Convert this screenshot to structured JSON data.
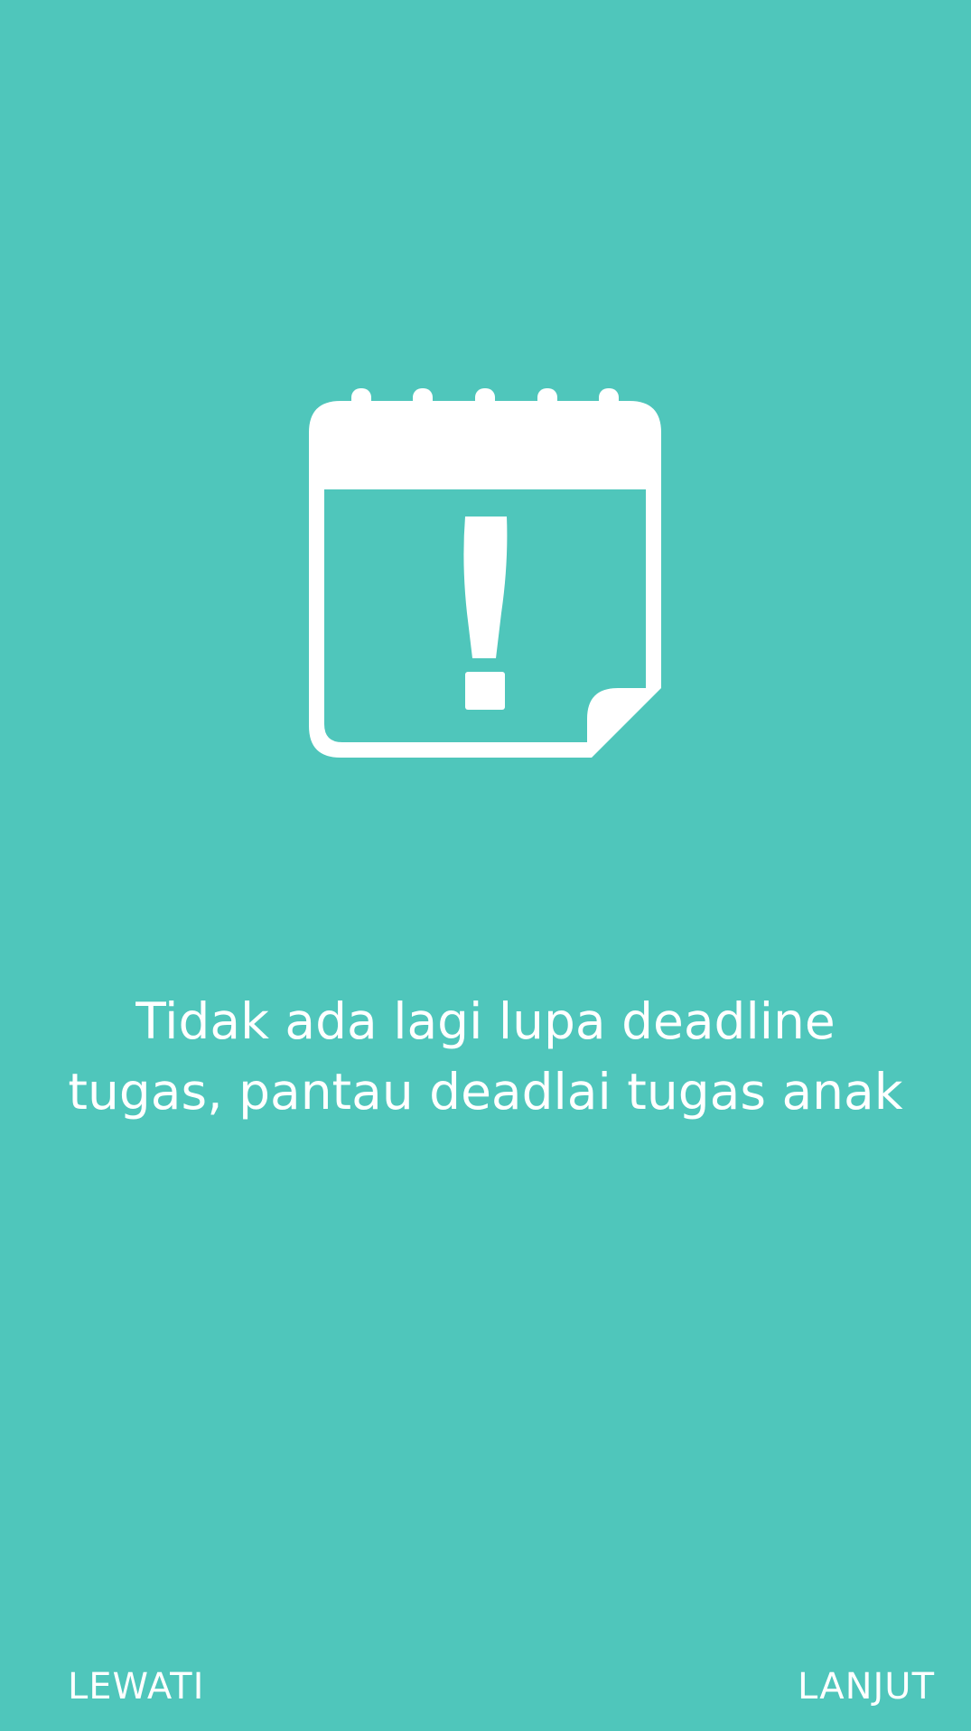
{
  "onboarding": {
    "background_color": "#4fc6bb",
    "icon": "calendar-alert-icon",
    "message_lines": [
      "Tidak ada lagi lupa deadline",
      "tugas, pantau deadlai tugas anak"
    ],
    "skip_label": "LEWATI",
    "next_label": "LANJUT"
  }
}
